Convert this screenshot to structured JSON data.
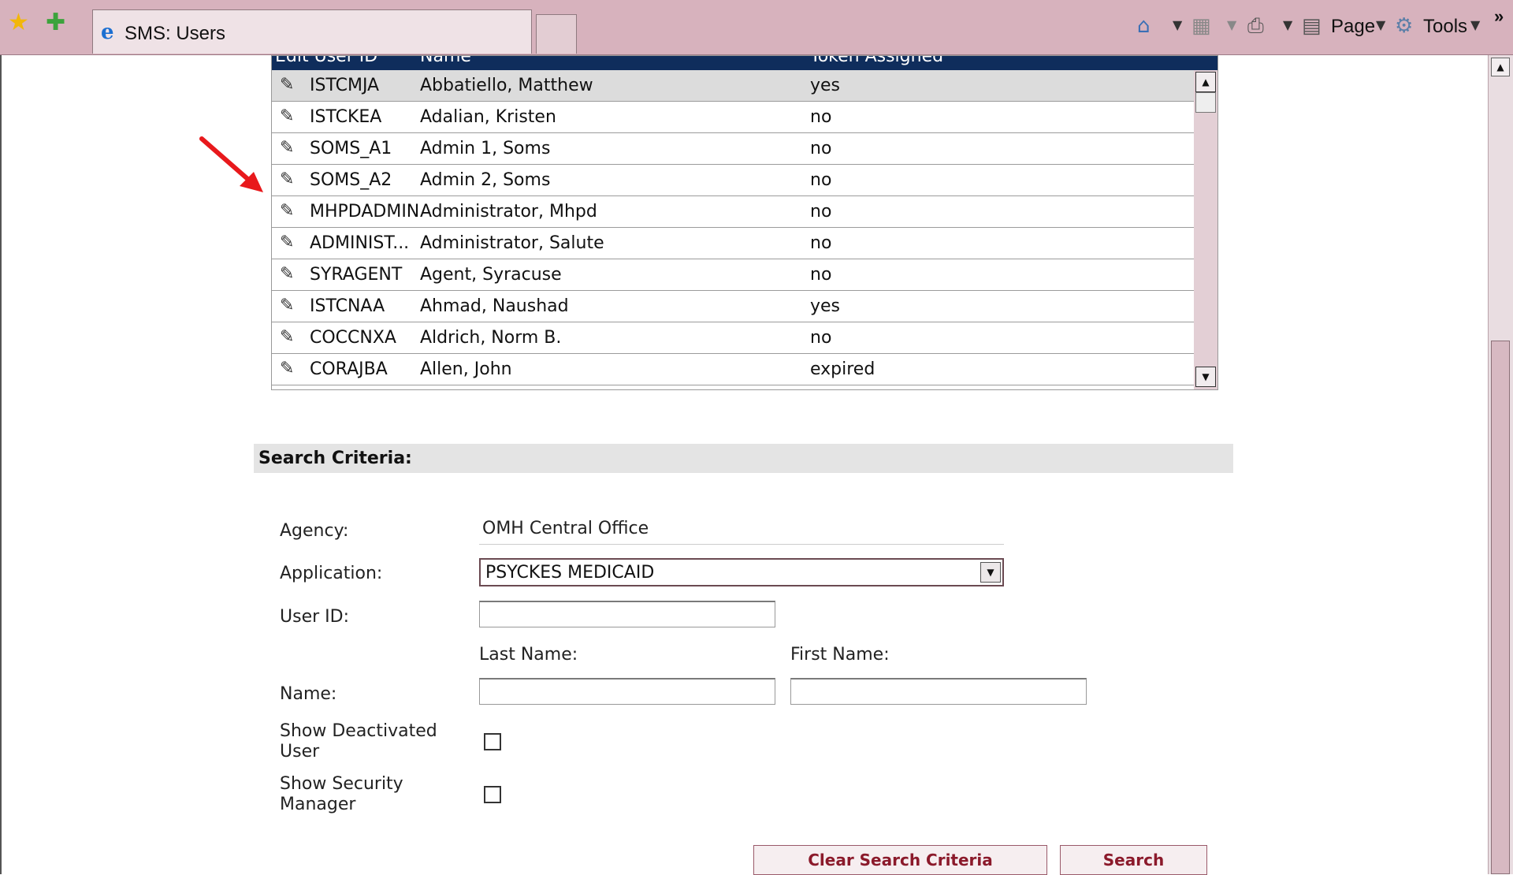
{
  "browser": {
    "tab_title": "SMS: Users",
    "page_menu": "Page",
    "tools_menu": "Tools",
    "overflow": "»"
  },
  "grid": {
    "columns": [
      "Edit User ID",
      "Name",
      "Token Assigned"
    ],
    "rows": [
      {
        "user_id": "ISTCMJA",
        "name": "Abbatiello, Matthew",
        "token": "yes",
        "selected": true
      },
      {
        "user_id": "ISTCKEA",
        "name": "Adalian, Kristen",
        "token": "no"
      },
      {
        "user_id": "SOMS_A1",
        "name": "Admin 1, Soms",
        "token": "no"
      },
      {
        "user_id": "SOMS_A2",
        "name": "Admin 2, Soms",
        "token": "no"
      },
      {
        "user_id": "MHPDADMIN",
        "name": "Administrator, Mhpd",
        "token": "no"
      },
      {
        "user_id": "ADMINIST...",
        "name": "Administrator, Salute",
        "token": "no"
      },
      {
        "user_id": "SYRAGENT",
        "name": "Agent, Syracuse",
        "token": "no"
      },
      {
        "user_id": "ISTCNAA",
        "name": "Ahmad, Naushad",
        "token": "yes"
      },
      {
        "user_id": "COCCNXA",
        "name": "Aldrich, Norm B.",
        "token": "no"
      },
      {
        "user_id": "CORAJBA",
        "name": "Allen, John",
        "token": "expired"
      }
    ]
  },
  "search": {
    "heading": "Search Criteria:",
    "agency_label": "Agency:",
    "agency_value": "OMH Central Office",
    "application_label": "Application:",
    "application_value": "PSYCKES MEDICAID",
    "user_id_label": "User ID:",
    "last_name_label": "Last Name:",
    "first_name_label": "First Name:",
    "name_label": "Name:",
    "show_deactivated_line1": "Show Deactivated",
    "show_deactivated_line2": "User",
    "show_security_line1": "Show Security",
    "show_security_line2": "Manager",
    "clear_button": "Clear Search Criteria",
    "search_button": "Search"
  },
  "annotation": {
    "arrow_color": "#e8191c"
  }
}
